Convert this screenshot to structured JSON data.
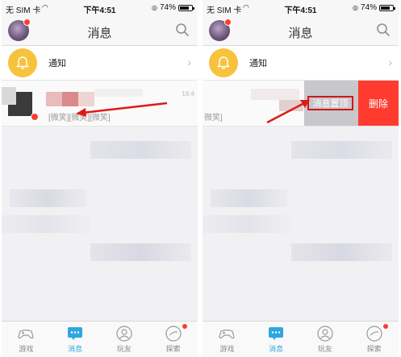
{
  "status_bar": {
    "carrier": "无 SIM 卡",
    "wifi_icon": "wifi-icon",
    "time": "下午4:51",
    "battery": "74%"
  },
  "nav": {
    "title": "消息",
    "avatar_icon": "avatar",
    "search_icon": "search-icon"
  },
  "notify": {
    "label": "通知",
    "icon": "bell-icon"
  },
  "message": {
    "preview": "[微笑][微笑][微笑]",
    "preview_partial": "微笑]",
    "time_partial": "16:4"
  },
  "swipe_actions": {
    "pin_label": "消息置顶",
    "delete_label": "删除"
  },
  "tabs": [
    {
      "label": "游戏",
      "icon": "gamepad-icon"
    },
    {
      "label": "消息",
      "icon": "chat-icon"
    },
    {
      "label": "玩友",
      "icon": "friends-icon"
    },
    {
      "label": "探索",
      "icon": "explore-icon"
    }
  ],
  "colors": {
    "accent": "#2ea7e0",
    "delete": "#ff3b30",
    "bell": "#f7c23c",
    "highlight": "#d41616"
  }
}
